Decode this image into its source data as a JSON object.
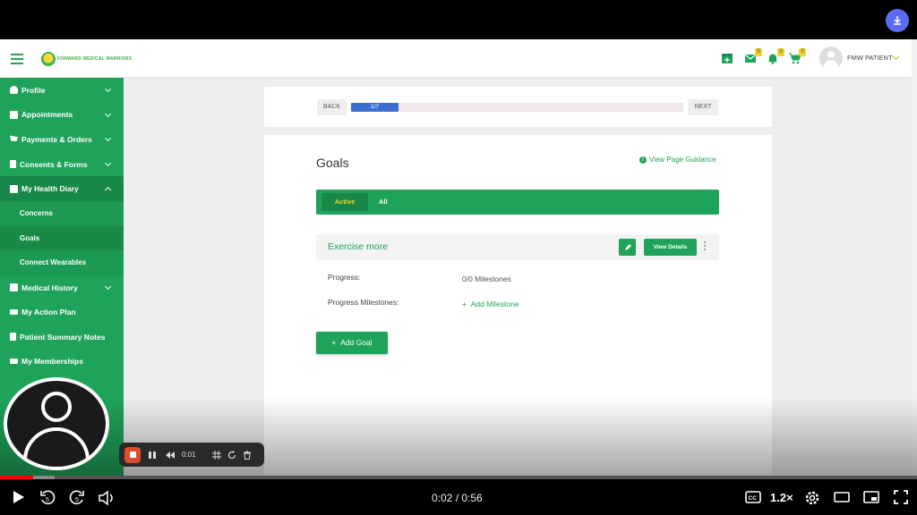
{
  "header": {
    "logo_text": "FORWARD MEDICAL WARRIORS",
    "user_name": "FMW PATIENT",
    "mail_badge": "0",
    "bell_badge": "0",
    "cart_badge": "0"
  },
  "sidebar": {
    "items": [
      {
        "label": "Profile"
      },
      {
        "label": "Appointments"
      },
      {
        "label": "Payments & Orders"
      },
      {
        "label": "Consents & Forms"
      },
      {
        "label": "My Health Diary"
      },
      {
        "label": "Concerns"
      },
      {
        "label": "Goals"
      },
      {
        "label": "Connect Wearables"
      },
      {
        "label": "Medical History"
      },
      {
        "label": "My Action Plan"
      },
      {
        "label": "Patient Summary Notes"
      },
      {
        "label": "My Memberships"
      }
    ]
  },
  "wizard": {
    "back_label": "BACK",
    "next_label": "NEXT",
    "step_text": "1/7",
    "progress_fraction": 0.143
  },
  "goals": {
    "title": "Goals",
    "guidance_link": "View Page Guidance",
    "tabs": {
      "active": "Active",
      "all": "All"
    },
    "goal_name": "Exercise more",
    "view_details": "View Details",
    "progress_label": "Progress:",
    "progress_value": "0/0 Milestones",
    "milestones_label": "Progress Milestones:",
    "add_milestone": "Add Milestone",
    "add_goal": "Add Goal"
  },
  "recorder": {
    "elapsed": "0:01"
  },
  "player": {
    "time": "0:02 / 0:56",
    "speed": "1.2×",
    "played_fraction": 0.036
  },
  "colors": {
    "brand_green": "#1fa35a",
    "progress_blue": "#3d6fd1",
    "badge_yellow": "#f2d22a"
  }
}
